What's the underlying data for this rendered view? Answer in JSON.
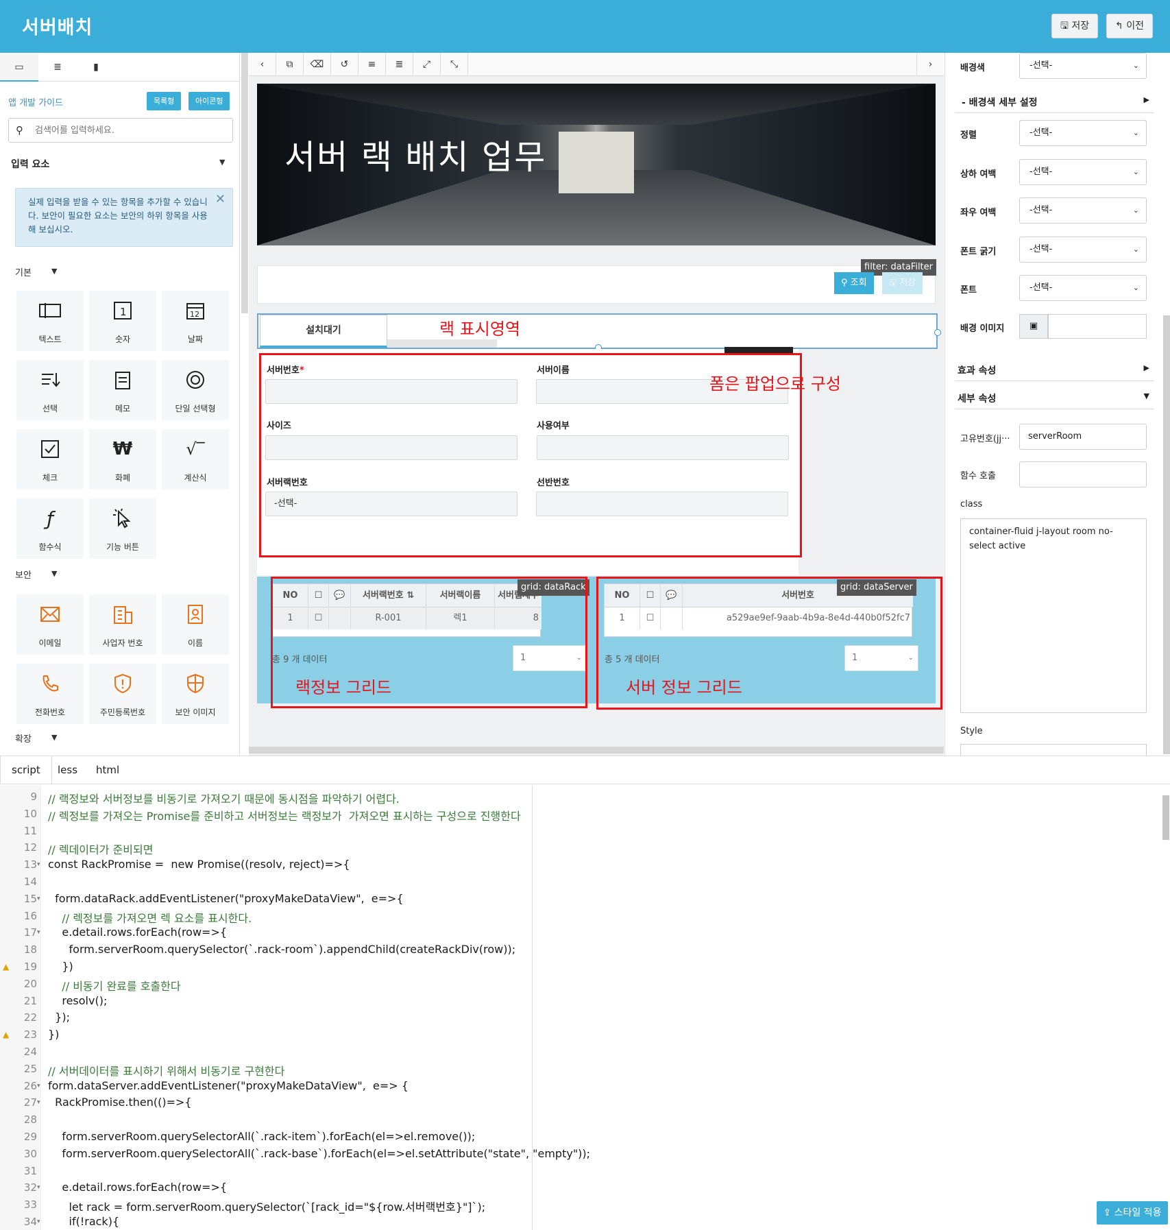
{
  "header": {
    "title": "서버배치",
    "save_label": "저장",
    "back_label": "이전"
  },
  "left": {
    "guide_link": "앱 개발 가이드",
    "view_list": "목록형",
    "view_icon": "아이콘형",
    "search_placeholder": "검색어를 입력하세요.",
    "section_input": "입력 요소",
    "info": "실제 입력을 받을 수 있는 항목을 추가할 수 있습니다. 보안이 필요한 요소는 보안의 하위 항목을 사용해 보십시오.",
    "sub_basic": "기본",
    "sub_security": "보안",
    "sub_ext": "확장",
    "basic": [
      "텍스트",
      "숫자",
      "날짜",
      "선택",
      "메모",
      "단일 선택형",
      "체크",
      "화폐",
      "계산식",
      "함수식",
      "기능 버튼"
    ],
    "security": [
      "이메일",
      "사업자 번호",
      "이름",
      "전화번호",
      "주민등록번호",
      "보안 이미지"
    ]
  },
  "canvas": {
    "banner_title": "서버 랙 배치 업무",
    "filter_tag": "filter: dataFilter",
    "query_btn": "조회",
    "save_btn": "저장",
    "rack_tab": "설치대기",
    "note_rack": "랙 표시영역",
    "note_form": "폼은 팝업으로 구성",
    "note_rack_grid": "랙정보 그리드",
    "note_server_grid": "서버 정보 그리드",
    "form_fields": {
      "server_no": "서버번호",
      "server_name": "서버이름",
      "size": "사이즈",
      "use_yn": "사용여부",
      "rack_no": "서버랙번호",
      "shelf_no": "선반번호",
      "rack_select": "-선택-"
    },
    "rack_grid": {
      "tag": "grid: dataRack",
      "columns": [
        "NO",
        "",
        "",
        "서버랙번호",
        "서버랙이름",
        "서버랩세부"
      ],
      "row": [
        "1",
        "",
        "",
        "R-001",
        "렉1",
        "8"
      ],
      "count": "총 9 개 데이터",
      "page": "1"
    },
    "server_grid": {
      "tag": "grid: dataServer",
      "columns": [
        "NO",
        "",
        "",
        "서버번호"
      ],
      "row": [
        "1",
        "",
        "",
        "a529ae9ef-9aab-4b9a-8e4d-440b0f52fc7"
      ],
      "count": "총 5 개 데이터",
      "page": "1"
    }
  },
  "right": {
    "bg_color": "배경색",
    "bg_detail": "- 배경색 세부 설정",
    "align": "정렬",
    "v_margin": "상하 여백",
    "h_margin": "좌우 여백",
    "font_weight": "폰트 굵기",
    "font": "폰트",
    "bg_image": "배경 이미지",
    "effect": "효과 속성",
    "detail": "세부 속성",
    "uid_label": "고유번호(jj···",
    "uid_value": "serverRoom",
    "func_call": "함수 호출",
    "class_label": "class",
    "class_value": "container-fluid j-layout room no-select active",
    "style_label": "Style",
    "select_default": "-선택-"
  },
  "editor": {
    "tabs": [
      "script",
      "less",
      "html"
    ],
    "apply_style": "스타일 적용",
    "lines": [
      {
        "n": "9",
        "t": "// 랙정보와 서버정보를 비동기로 가져오기 때문에 동시점을 파악하기 어렵다."
      },
      {
        "n": "10",
        "t": "// 렉정보를 가져오는 Promise를 준비하고 서버정보는 랙정보가  가져오면 표시하는 구성으로 진행한다"
      },
      {
        "n": "11",
        "t": ""
      },
      {
        "n": "12",
        "t": "// 렉데이터가 준비되면"
      },
      {
        "n": "13",
        "t": "const RackPromise =  new Promise((resolv, reject)=>{"
      },
      {
        "n": "14",
        "t": ""
      },
      {
        "n": "15",
        "t": "  form.dataRack.addEventListener(\"proxyMakeDataView\",  e=>{"
      },
      {
        "n": "16",
        "t": "    // 렉정보를 가져오면 렉 요소를 표시한다."
      },
      {
        "n": "17",
        "t": "    e.detail.rows.forEach(row=>{"
      },
      {
        "n": "18",
        "t": "      form.serverRoom.querySelector(`.rack-room`).appendChild(createRackDiv(row));"
      },
      {
        "n": "19",
        "t": "    })"
      },
      {
        "n": "20",
        "t": "    // 비동기 완료를 호출한다"
      },
      {
        "n": "21",
        "t": "    resolv();"
      },
      {
        "n": "22",
        "t": "  });"
      },
      {
        "n": "23",
        "t": "})"
      },
      {
        "n": "24",
        "t": ""
      },
      {
        "n": "25",
        "t": "// 서버데이터를 표시하기 위해서 비동기로 구현한다"
      },
      {
        "n": "26",
        "t": "form.dataServer.addEventListener(\"proxyMakeDataView\",  e=> {"
      },
      {
        "n": "27",
        "t": "  RackPromise.then(()=>{"
      },
      {
        "n": "28",
        "t": ""
      },
      {
        "n": "29",
        "t": "    form.serverRoom.querySelectorAll(`.rack-item`).forEach(el=>el.remove());"
      },
      {
        "n": "30",
        "t": "    form.serverRoom.querySelectorAll(`.rack-base`).forEach(el=>el.setAttribute(\"state\", \"empty\"));"
      },
      {
        "n": "31",
        "t": ""
      },
      {
        "n": "32",
        "t": "    e.detail.rows.forEach(row=>{"
      },
      {
        "n": "33",
        "t": "      let rack = form.serverRoom.querySelector(`[rack_id=\"${row.서버랙번호}\"]`);"
      },
      {
        "n": "34",
        "t": "      if(!rack){"
      }
    ]
  }
}
